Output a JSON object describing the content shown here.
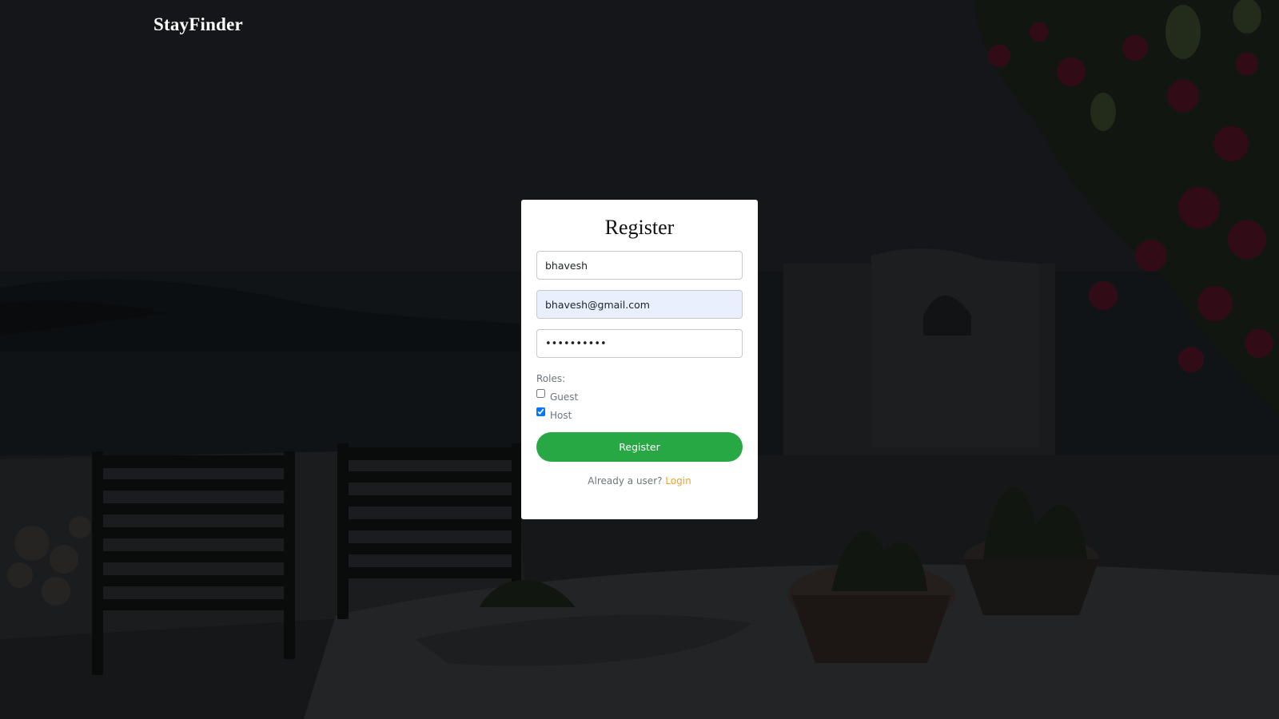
{
  "brand": {
    "name": "StayFinder"
  },
  "register_form": {
    "title": "Register",
    "username_value": "bhavesh",
    "email_value": "bhavesh@gmail.com",
    "password_value": "••••••••••",
    "roles_label": "Roles:",
    "roles": [
      {
        "label": "Guest",
        "checked": false
      },
      {
        "label": "Host",
        "checked": true
      }
    ],
    "submit_label": "Register",
    "already_user_text": "Already a user?",
    "login_link_label": "Login"
  },
  "colors": {
    "submit_button": "#28a745",
    "login_link": "#f0a030",
    "email_autofill_bg": "#e8f0fe",
    "card_bg": "#ffffff"
  }
}
